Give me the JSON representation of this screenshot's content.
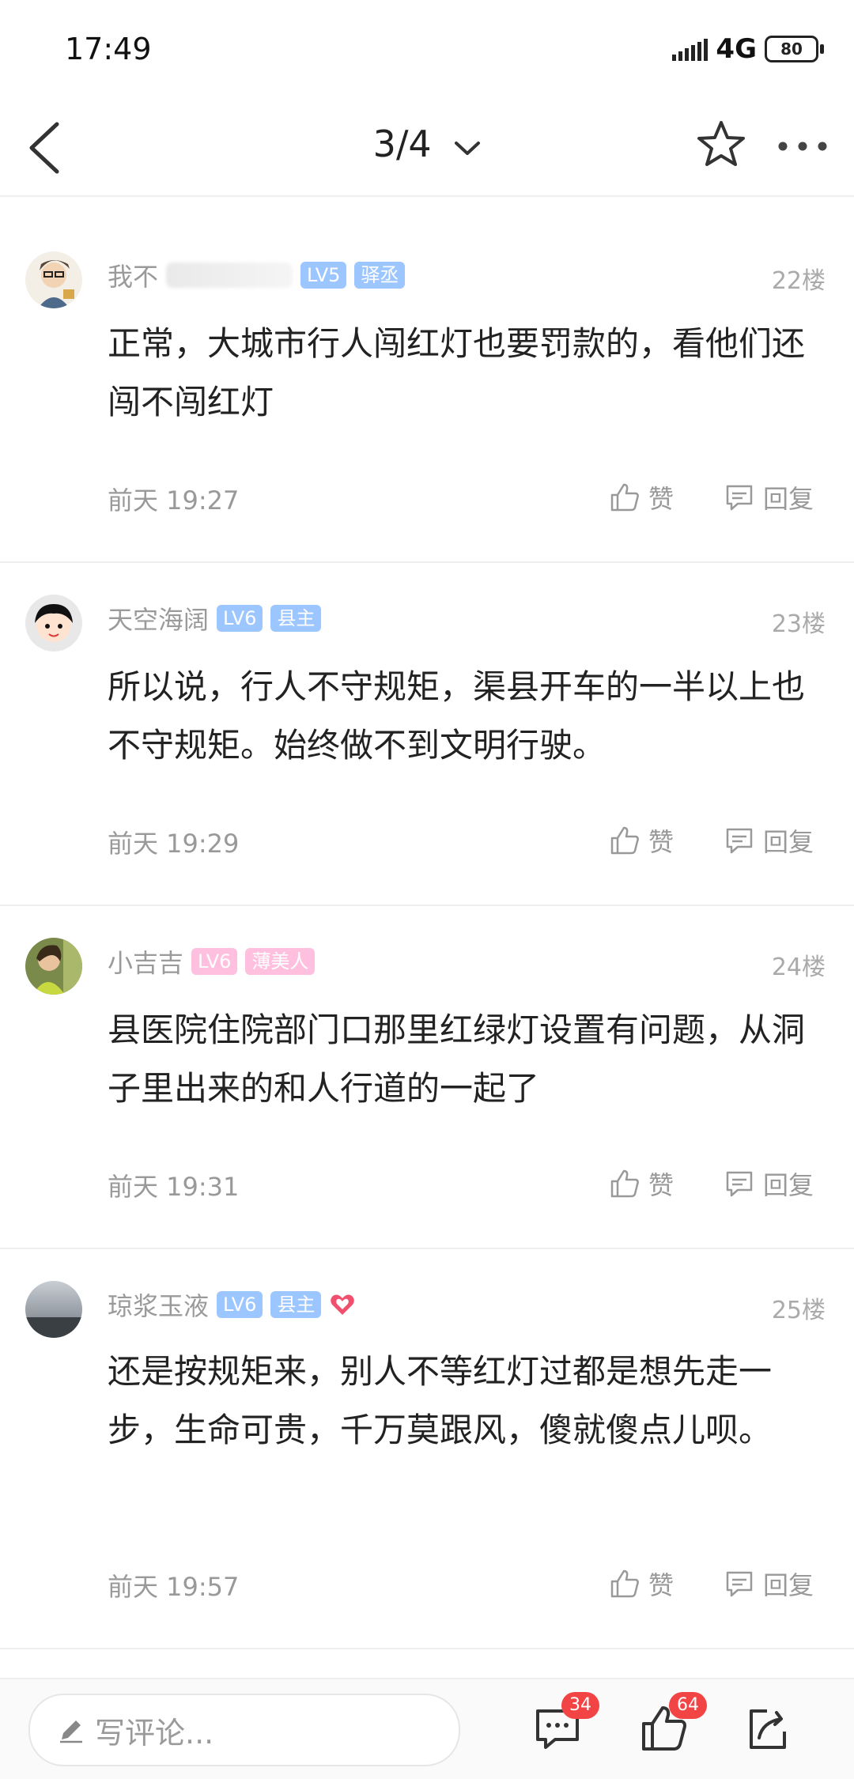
{
  "status_bar": {
    "time": "17:49",
    "network": "4G",
    "battery": "80"
  },
  "nav": {
    "title": "3/4"
  },
  "comments": [
    {
      "name": "我不",
      "level": "LV5",
      "title": "驿丞",
      "floor": "22楼",
      "content": "正常，大城市行人闯红灯也要罚款的，看他们还闯不闯红灯",
      "time": "前天 19:27",
      "like": "赞",
      "reply": "回复"
    },
    {
      "name": "天空海阔",
      "level": "LV6",
      "title": "县主",
      "floor": "23楼",
      "content": "所以说，行人不守规矩，渠县开车的一半以上也不守规矩。始终做不到文明行驶。",
      "time": "前天 19:29",
      "like": "赞",
      "reply": "回复"
    },
    {
      "name": "小吉吉",
      "level": "LV6",
      "title": "薄美人",
      "floor": "24楼",
      "content": "县医院住院部门口那里红绿灯设置有问题，从洞子里出来的和人行道的一起了",
      "time": "前天 19:31",
      "like": "赞",
      "reply": "回复"
    },
    {
      "name": "琼浆玉液",
      "level": "LV6",
      "title": "县主",
      "floor": "25楼",
      "content": "还是按规矩来，别人不等红灯过都是想先走一步，生命可贵，千万莫跟风，傻就傻点儿呗。",
      "time": "前天 19:57",
      "like": "赞",
      "reply": "回复"
    }
  ],
  "bottom_bar": {
    "placeholder": "写评论...",
    "comment_count": "34",
    "like_count": "64"
  }
}
